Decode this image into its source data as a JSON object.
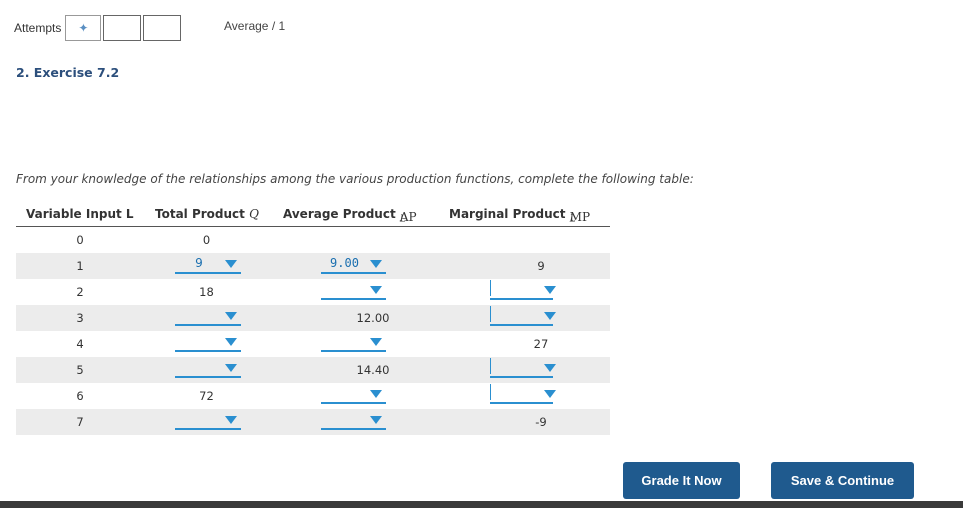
{
  "attempts": {
    "label": "Attempts"
  },
  "score": {
    "text": "Average / 1"
  },
  "exercise": {
    "title": "2. Exercise 7.2"
  },
  "instruction": "From your knowledge of the relationships among the various production functions, complete the following table:",
  "table": {
    "headers": {
      "variable_input": "Variable Input L",
      "total_product": "Total Product ",
      "total_product_sym": "Q",
      "average_product": "Average Product ",
      "average_product_sym": "AP",
      "marginal_product": "Marginal Product ",
      "marginal_product_sym": "MP",
      "sub": "L"
    },
    "rows": [
      {
        "l": "0",
        "tp": "0",
        "ap": "",
        "mp": ""
      },
      {
        "l": "1",
        "tp": "9",
        "ap": "9.00",
        "mp": "9"
      },
      {
        "l": "2",
        "tp": "18",
        "ap": "",
        "mp": ""
      },
      {
        "l": "3",
        "tp": "",
        "ap": "12.00",
        "mp": ""
      },
      {
        "l": "4",
        "tp": "",
        "ap": "",
        "mp": "27"
      },
      {
        "l": "5",
        "tp": "",
        "ap": "14.40",
        "mp": ""
      },
      {
        "l": "6",
        "tp": "72",
        "ap": "",
        "mp": ""
      },
      {
        "l": "7",
        "tp": "",
        "ap": "",
        "mp": "-9"
      }
    ]
  },
  "buttons": {
    "grade": "Grade It Now",
    "save": "Save & Continue"
  },
  "colors": {
    "accent": "#2a8fd0",
    "button": "#1f5a8e",
    "title": "#2c4f7c"
  }
}
